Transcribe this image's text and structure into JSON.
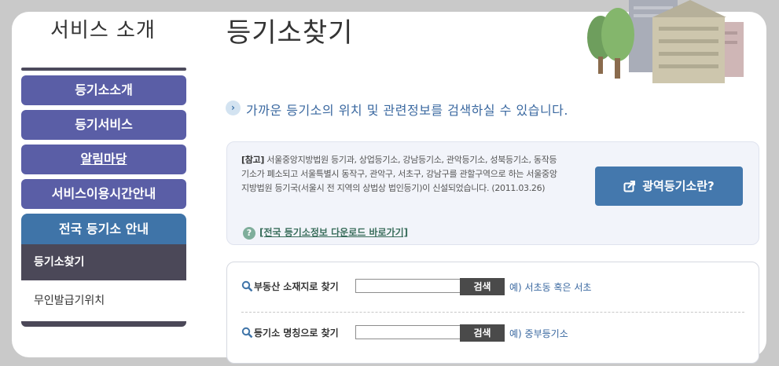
{
  "sidebar": {
    "title": "서비스 소개",
    "items": [
      {
        "label": "등기소소개"
      },
      {
        "label": "등기서비스"
      },
      {
        "label": "알림마당"
      },
      {
        "label": "서비스이용시간안내"
      },
      {
        "label": "전국 등기소 안내"
      }
    ],
    "subitems": [
      {
        "label": "등기소찾기"
      },
      {
        "label": "무인발급기위치"
      }
    ]
  },
  "main": {
    "title": "등기소찾기",
    "intro": "가까운 등기소의 위치 및 관련정보를 검색하실 수 있습니다.",
    "notice": {
      "tag": "[참고]",
      "text": " 서울중앙지방법원 등기과, 상업등기소, 강남등기소, 관악등기소, 성북등기소, 동작등기소가 폐소되고 서울특별시 동작구, 관악구, 서초구, 강남구를 관할구역으로 하는 서울중앙지방법원 등기국(서울시 전 지역의 상법상 법인등기)이 신설되었습니다. (2011.03.26)",
      "link": "[전국 등기소정보 다운로드 바로가기]",
      "button": "광역등기소란?"
    },
    "search": {
      "row1": {
        "label": "부동산 소재지로 찾기",
        "value": "",
        "button": "검색",
        "example": "예) 서초동 혹은 서초"
      },
      "row2": {
        "label": "등기소 명칭으로 찾기",
        "value": "",
        "button": "검색",
        "example": "예) 중부등기소"
      }
    }
  },
  "colors": {
    "nav": "#5a5ea6",
    "nav_active": "#3f74a8",
    "sub_active": "#4b4858",
    "accent_button": "#4478ad",
    "background": "#c9c9c9"
  }
}
